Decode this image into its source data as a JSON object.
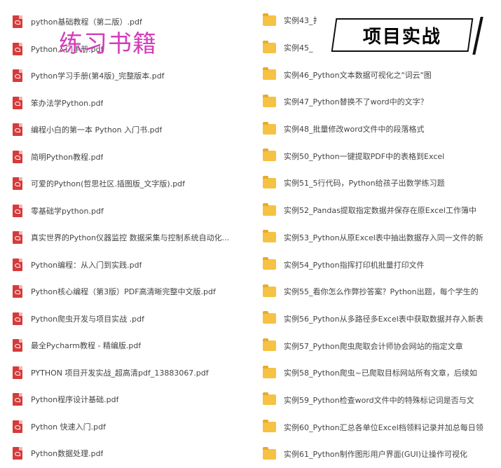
{
  "overlay": {
    "left_title": "练习书籍",
    "right_title": "项目实战"
  },
  "pdf_files": [
    "python基础教程（第二版）.pdf",
    "Python入门手册.pdf",
    "Python学习手册(第4版)_完整版本.pdf",
    "笨办法学Python.pdf",
    "编程小白的第一本 Python 入门书.pdf",
    "简明Python教程.pdf",
    "可爱的Python(哲思社区.插图版_文字版).pdf",
    "零基础学python.pdf",
    "真实世界的Python仪器监控  数据采集与控制系统自动化...",
    "Python编程：从入门到实践.pdf",
    "Python核心编程（第3版）PDF高清晰完整中文版.pdf",
    "Python爬虫开发与项目实战 .pdf",
    "最全Pycharm教程 - 精编版.pdf",
    "PYTHON 项目开发实战_超高清pdf_13883067.pdf",
    "Python程序设计基础.pdf",
    "Python 快速入门.pdf",
    "Python数据处理.pdf"
  ],
  "folders": [
    "实例43_扌",
    "实例45_",
    "实例46_Python文本数据可视化之\"词云\"图",
    "实例47_Python替换不了word中的文字？",
    "实例48_批量修改word文件中的段落格式",
    "实例50_Python一键提取PDF中的表格到Excel",
    "实例51_5行代码，Python给孩子出数学练习题",
    "实例52_Pandas提取指定数据并保存在原Excel工作簿中",
    "实例53_Python从原Excel表中抽出数据存入同一文件的新",
    "实例54_Python指挥打印机批量打印文件",
    "实例55_看你怎么作弊抄答案？Python出题，每个学生的",
    "实例56_Python从多路径多Excel表中获取数据并存入新表",
    "实例57_Python爬虫爬取会计师协会网站的指定文章",
    "实例58_Python爬虫~已爬取目标网站所有文章，后续如",
    "实例59_Python检查word文件中的特殊标记词是否与文",
    "实例60_Python汇总各单位Excel档领料记录并加总每日领",
    "实例61_Python制作图形用户界面(GUI)让操作可视化"
  ],
  "icons": {
    "pdf": "pdf-file-icon",
    "folder": "folder-icon"
  },
  "colors": {
    "pdf_icon": "#d63b3b",
    "folder_icon": "#f5c243",
    "overlay_left": "#d43dbb",
    "banner_border": "#111111"
  }
}
